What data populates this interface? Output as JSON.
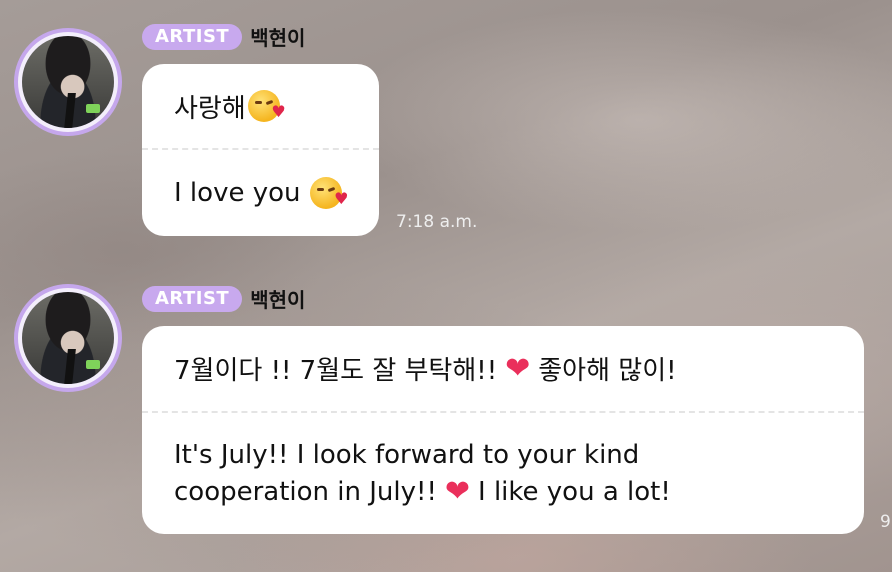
{
  "messages": [
    {
      "badge": "ARTIST",
      "name": "백현이",
      "korean": "사랑해",
      "english": "I love you",
      "time": "7:18 a.m."
    },
    {
      "badge": "ARTIST",
      "name": "백현이",
      "korean_part1": "7월이다 !! 7월도 잘 부탁해!!",
      "korean_part2": "좋아해 많이!",
      "english_line1": "It's July!! I look forward to your kind",
      "english_part2": "cooperation in July!!",
      "english_part3": "I like you a lot!",
      "time": "9"
    }
  ],
  "icons": {
    "kiss_emoji": "face-blowing-kiss-icon",
    "heart_emoji": "red-heart-icon"
  },
  "colors": {
    "artist_badge": "#c8a9ee",
    "avatar_ring": "#c5a7ec",
    "bubble": "#ffffff"
  }
}
